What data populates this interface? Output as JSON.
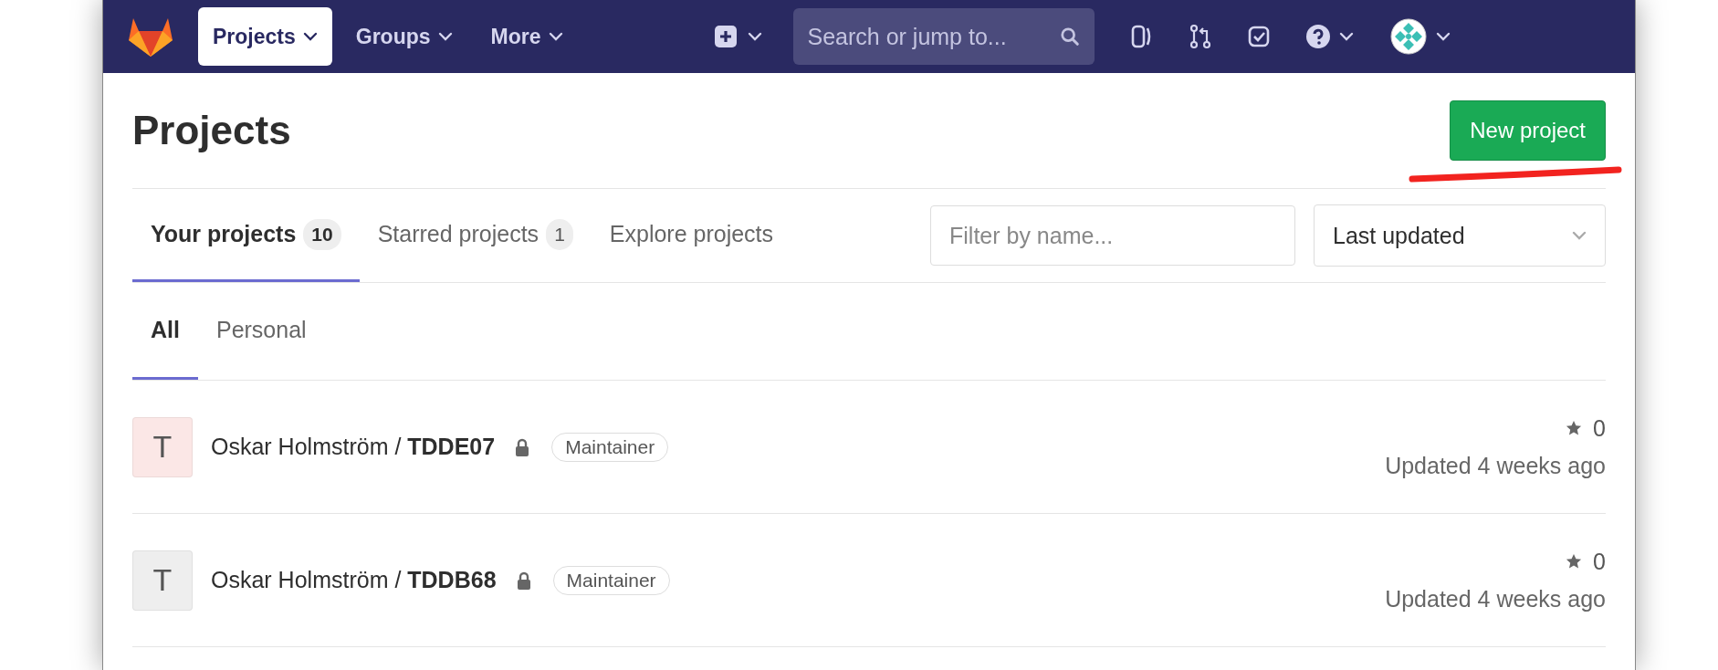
{
  "navbar": {
    "items": [
      {
        "label": "Projects",
        "selected": true
      },
      {
        "label": "Groups",
        "selected": false
      },
      {
        "label": "More",
        "selected": false
      }
    ],
    "search": {
      "placeholder": "Search or jump to..."
    }
  },
  "page": {
    "title": "Projects",
    "new_button": "New project",
    "annotation": true
  },
  "tabs": [
    {
      "label": "Your projects",
      "count": "10",
      "selected": true
    },
    {
      "label": "Starred projects",
      "count": "1",
      "selected": false
    },
    {
      "label": "Explore projects",
      "selected": false
    }
  ],
  "filter": {
    "placeholder": "Filter by name..."
  },
  "sort": {
    "value": "Last updated"
  },
  "subtabs": [
    {
      "label": "All",
      "selected": true
    },
    {
      "label": "Personal",
      "selected": false
    }
  ],
  "projects": [
    {
      "letter": "T",
      "color": "#fbe7e6",
      "name": "Oskar Holmström / **TDDE07**",
      "private": true,
      "role": "Maintainer",
      "stars": "0",
      "updated": "Updated 4 weeks ago"
    },
    {
      "letter": "T",
      "color": "#eeeeee",
      "name": "Oskar Holmström / **TDDB68**",
      "private": true,
      "role": "Maintainer",
      "stars": "0",
      "updated": "Updated 4 weeks ago"
    }
  ]
}
